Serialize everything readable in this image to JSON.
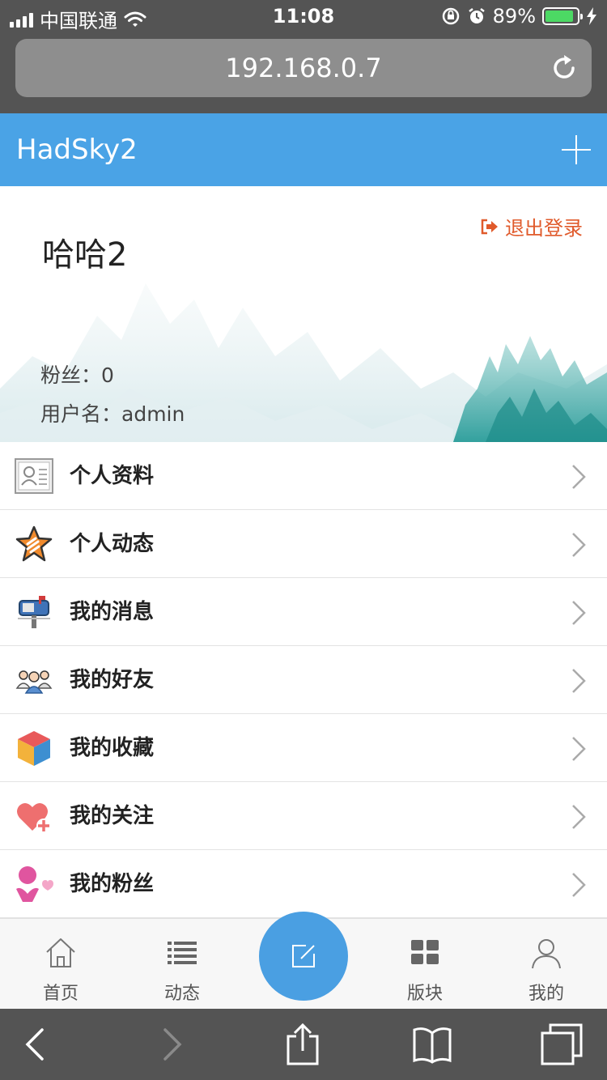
{
  "status_bar": {
    "carrier": "中国联通",
    "time": "11:08",
    "battery_percent": "89%",
    "battery_level": 0.89
  },
  "browser": {
    "url": "192.168.0.7"
  },
  "header": {
    "title": "HadSky2"
  },
  "profile": {
    "name": "哈哈2",
    "logout_label": "退出登录",
    "fans_label": "粉丝：0",
    "username_label": "用户名：admin"
  },
  "menu": {
    "items": [
      {
        "label": "个人资料",
        "icon": "profile-card-icon"
      },
      {
        "label": "个人动态",
        "icon": "star-icon"
      },
      {
        "label": "我的消息",
        "icon": "mailbox-icon"
      },
      {
        "label": "我的好友",
        "icon": "friends-icon"
      },
      {
        "label": "我的收藏",
        "icon": "cube-icon"
      },
      {
        "label": "我的关注",
        "icon": "heart-plus-icon"
      },
      {
        "label": "我的粉丝",
        "icon": "fan-person-icon"
      }
    ]
  },
  "tabbar": {
    "tabs": [
      {
        "label": "首页",
        "icon": "home-icon"
      },
      {
        "label": "动态",
        "icon": "list-icon"
      },
      {
        "label": "版块",
        "icon": "grid-icon"
      },
      {
        "label": "我的",
        "icon": "user-icon"
      }
    ],
    "compose_icon": "compose-icon"
  },
  "colors": {
    "header_blue": "#4aa3e6",
    "logout_orange": "#e05a2b",
    "fab_blue": "#4a9fe2",
    "browser_chrome": "#545454"
  }
}
